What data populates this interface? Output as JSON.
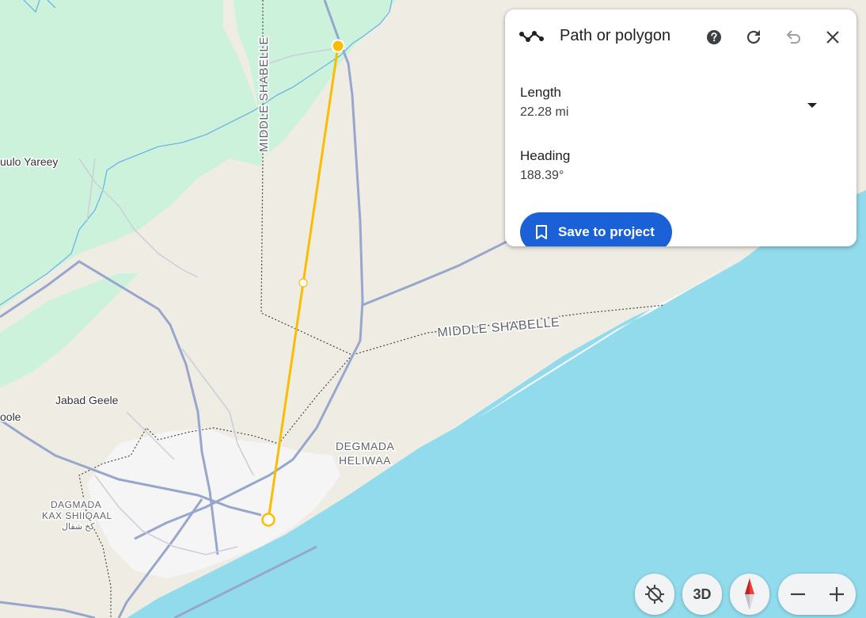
{
  "map": {
    "labels": {
      "culo_yareey": "uulo Yareey",
      "jabad_geele": "Jabad Geele",
      "oole": "oole",
      "degmada_heliwaa_1": "DEGMADA",
      "degmada_heliwaa_2": "HELIWAA",
      "degmada_kax_1": "DAGMADA",
      "degmada_kax_2": "KAX SHIIQAAL",
      "degmada_kax_arabic": "كخ شقال",
      "middle_shabelle_vertical": "MIDDLE SHABELLE",
      "middle_shabelle_diagonal": "MIDDLE SHABELLE"
    },
    "colors": {
      "land": "#efece4",
      "forest": "#cdf2dc",
      "ocean": "#91dbed",
      "road": "#97a6cc",
      "measure_line": "#fbbc04",
      "river": "#68b6e8"
    }
  },
  "panel": {
    "title": "Path or polygon",
    "icons": {
      "path": "path-polyline-icon",
      "help": "help-icon",
      "redo": "refresh-icon",
      "undo": "undo-icon",
      "close": "close-icon"
    },
    "length_label": "Length",
    "length_value": "22.28 mi",
    "heading_label": "Heading",
    "heading_value": "188.39°",
    "save_label": "Save to project",
    "accent_color": "#1a60d6"
  },
  "controls": {
    "locate_icon": "location-disabled-icon",
    "three_d_label": "3D",
    "compass_icon": "compass-icon",
    "zoom_out_icon": "minus-icon",
    "zoom_in_icon": "plus-icon"
  }
}
